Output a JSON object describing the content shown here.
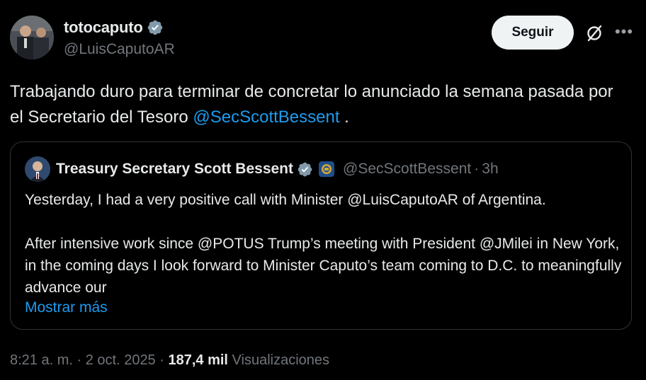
{
  "author": {
    "display_name": "totocaputo",
    "handle": "@LuisCaputoAR",
    "verified_color": "#829aab"
  },
  "actions": {
    "follow_label": "Seguir",
    "grok_icon": "grok-icon",
    "more_icon": "more-icon"
  },
  "tweet": {
    "text_before": "Trabajando duro para terminar de  concretar lo anunciado la semana pasada por el Secretario del Tesoro ",
    "mention": "@SecScottBessent",
    "text_after": " ."
  },
  "quoted": {
    "display_name": "Treasury Secretary Scott Bessent",
    "handle": "@SecScottBessent",
    "separator": "·",
    "time": "3h",
    "paragraph1": "Yesterday, I had a very positive call with Minister @LuisCaputoAR of Argentina.",
    "paragraph2": "After intensive work since @POTUS Trump’s meeting with President @JMilei in New York, in the coming days I look forward to Minister Caputo’s team coming to D.C. to meaningfully advance our",
    "show_more": "Mostrar más"
  },
  "meta": {
    "time": "8:21 a. m.",
    "sep1": " · ",
    "date": "2 oct. 2025",
    "sep2": " · ",
    "views_count": "187,4 mil",
    "views_label": "Visualizaciones"
  },
  "colors": {
    "background": "#000000",
    "text": "#e7e9ea",
    "secondary": "#71767b",
    "link": "#1d9bf0",
    "border": "#2f3336"
  }
}
